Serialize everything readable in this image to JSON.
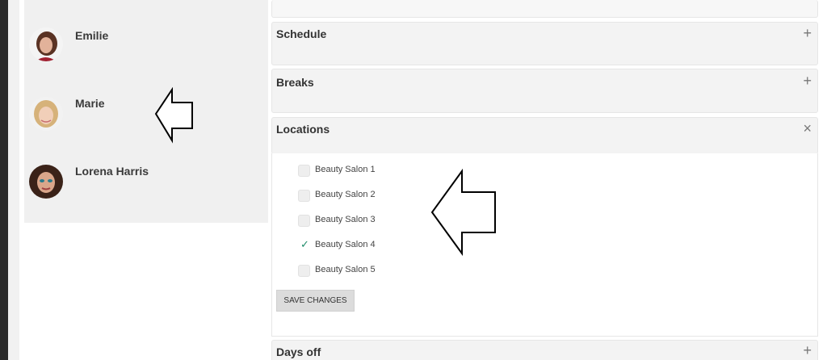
{
  "staff": [
    {
      "name": "Emilie"
    },
    {
      "name": "Marie"
    },
    {
      "name": "Lorena Harris"
    }
  ],
  "panels": {
    "schedule": {
      "title": "Schedule",
      "toggle": "+"
    },
    "breaks": {
      "title": "Breaks",
      "toggle": "+"
    },
    "locations": {
      "title": "Locations",
      "toggle": "×"
    },
    "days_off": {
      "title": "Days off",
      "toggle": "+"
    }
  },
  "locations": [
    {
      "label": "Beauty Salon 1",
      "checked": false
    },
    {
      "label": "Beauty Salon 2",
      "checked": false
    },
    {
      "label": "Beauty Salon 3",
      "checked": false
    },
    {
      "label": "Beauty Salon 4",
      "checked": true
    },
    {
      "label": "Beauty Salon 5",
      "checked": false
    }
  ],
  "save_label": "SAVE CHANGES",
  "colors": {
    "check": "#1f8c6a",
    "panel_bg": "#f3f3f3",
    "staff_bg": "#f0f0f0"
  }
}
